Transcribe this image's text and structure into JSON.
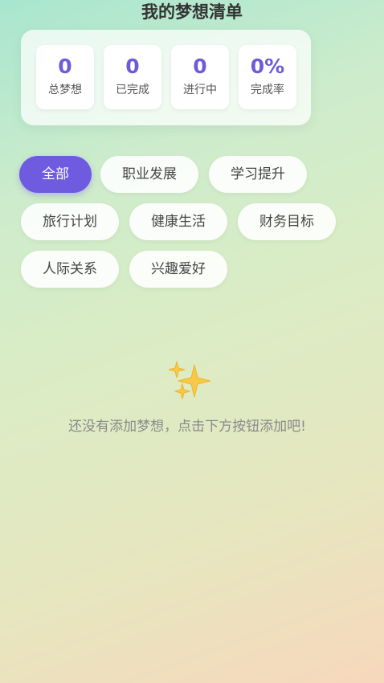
{
  "header": {
    "title": "我的梦想清单"
  },
  "stats": [
    {
      "value": "0",
      "label": "总梦想"
    },
    {
      "value": "0",
      "label": "已完成"
    },
    {
      "value": "0",
      "label": "进行中"
    },
    {
      "value": "0%",
      "label": "完成率"
    }
  ],
  "categories": {
    "selected": "全部",
    "items": [
      {
        "label": "全部"
      },
      {
        "label": "职业发展"
      },
      {
        "label": "学习提升"
      },
      {
        "label": "旅行计划"
      },
      {
        "label": "健康生活"
      },
      {
        "label": "财务目标"
      },
      {
        "label": "人际关系"
      },
      {
        "label": "兴趣爱好"
      }
    ]
  },
  "empty_state": {
    "icon": "sparkles-icon",
    "message": "还没有添加梦想，点击下方按钮添加吧!"
  },
  "colors": {
    "accent": "#6f5be0",
    "stat_value": "#6f5bd8"
  }
}
